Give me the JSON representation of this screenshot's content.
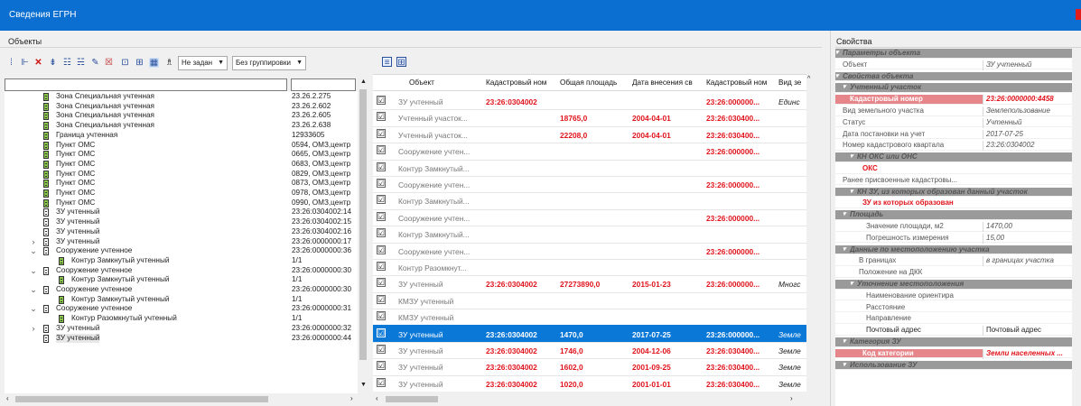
{
  "window": {
    "title": "Сведения ЕГРН"
  },
  "panels": {
    "objects": "Объекты",
    "properties": "Свойства"
  },
  "toolbar": {
    "mode_combo": "Не задан",
    "group_combo": "Без группировки"
  },
  "tree": {
    "rows": [
      {
        "name": "Зона Специальная учтенная",
        "code": "23.26.2.275",
        "expander": ""
      },
      {
        "name": "Зона Специальная учтенная",
        "code": "23.26.2.602",
        "expander": ""
      },
      {
        "name": "Зона Специальная учтенная",
        "code": "23.26.2.605",
        "expander": ""
      },
      {
        "name": "Зона Специальная учтенная",
        "code": "23.26.2.638",
        "expander": ""
      },
      {
        "name": "Граница учтенная",
        "code": "12933605",
        "expander": ""
      },
      {
        "name": "Пункт ОМС",
        "code": "0594, ОМЗ,центр",
        "expander": ""
      },
      {
        "name": "Пункт ОМС",
        "code": "0665, ОМЗ,центр",
        "expander": ""
      },
      {
        "name": "Пункт ОМС",
        "code": "0683, ОМЗ,центр",
        "expander": ""
      },
      {
        "name": "Пункт ОМС",
        "code": "0829, ОМЗ,центр",
        "expander": ""
      },
      {
        "name": "Пункт ОМС",
        "code": "0873, ОМЗ,центр",
        "expander": ""
      },
      {
        "name": "Пункт ОМС",
        "code": "0978, ОМЗ,центр",
        "expander": ""
      },
      {
        "name": "Пункт ОМС",
        "code": "0990, ОМЗ,центр",
        "expander": ""
      },
      {
        "name": "ЗУ учтенный",
        "code": "23:26:0304002:14",
        "expander": ""
      },
      {
        "name": "ЗУ учтенный",
        "code": "23:26:0304002:15",
        "expander": ""
      },
      {
        "name": "ЗУ учтенный",
        "code": "23:26:0304002:16",
        "expander": ""
      },
      {
        "name": "ЗУ учтенный",
        "code": "23:26:0000000:17",
        "expander": "›"
      },
      {
        "name": "Сооружение учтенное",
        "code": "23:26:0000000:36",
        "expander": "⌄"
      },
      {
        "name": "Контур Замкнутый учтенный",
        "code": "1/1",
        "expander": ""
      },
      {
        "name": "Сооружение учтенное",
        "code": "23:26:0000000:30",
        "expander": "⌄"
      },
      {
        "name": "Контур Замкнутый учтенный",
        "code": "1/1",
        "expander": ""
      },
      {
        "name": "Сооружение учтенное",
        "code": "23:26:0000000:30",
        "expander": "⌄"
      },
      {
        "name": "Контур Замкнутый учтенный",
        "code": "1/1",
        "expander": ""
      },
      {
        "name": "Сооружение учтенное",
        "code": "23:26:0000000:31",
        "expander": "⌄"
      },
      {
        "name": "Контур Разомкнутый учтенный",
        "code": "1/1",
        "expander": ""
      },
      {
        "name": "ЗУ учтенный",
        "code": "23:26:0000000:32",
        "expander": "›"
      },
      {
        "name": "ЗУ учтенный",
        "code": "23:26:0000000:44",
        "expander": ""
      }
    ]
  },
  "grid": {
    "columns": [
      "Объект",
      "Кадастровый ном",
      "Общая площадь",
      "Дата внесения св",
      "Кадастровый ном",
      "Вид зе"
    ],
    "rows": [
      {
        "obj": "ЗУ учтенный",
        "kad": "23:26:0304002",
        "area": "",
        "date": "",
        "kad2": "23:26:000000...",
        "vid": "Единс"
      },
      {
        "obj": "Учтенный участок...",
        "kad": "",
        "area": "18765,0",
        "date": "2004-04-01",
        "kad2": "23:26:030400...",
        "vid": ""
      },
      {
        "obj": "Учтенный участок...",
        "kad": "",
        "area": "22208,0",
        "date": "2004-04-01",
        "kad2": "23:26:030400...",
        "vid": ""
      },
      {
        "obj": "Сооружение учтен...",
        "kad": "",
        "area": "",
        "date": "",
        "kad2": "23:26:000000...",
        "vid": ""
      },
      {
        "obj": "Контур Замкнутый...",
        "kad": "",
        "area": "",
        "date": "",
        "kad2": "",
        "vid": ""
      },
      {
        "obj": "Сооружение учтен...",
        "kad": "",
        "area": "",
        "date": "",
        "kad2": "23:26:000000...",
        "vid": ""
      },
      {
        "obj": "Контур Замкнутый...",
        "kad": "",
        "area": "",
        "date": "",
        "kad2": "",
        "vid": ""
      },
      {
        "obj": "Сооружение учтен...",
        "kad": "",
        "area": "",
        "date": "",
        "kad2": "23:26:000000...",
        "vid": ""
      },
      {
        "obj": "Контур Замкнутый...",
        "kad": "",
        "area": "",
        "date": "",
        "kad2": "",
        "vid": ""
      },
      {
        "obj": "Сооружение учтен...",
        "kad": "",
        "area": "",
        "date": "",
        "kad2": "23:26:000000...",
        "vid": ""
      },
      {
        "obj": "Контур Разомкнут...",
        "kad": "",
        "area": "",
        "date": "",
        "kad2": "",
        "vid": ""
      },
      {
        "obj": "ЗУ учтенный",
        "kad": "23:26:0304002",
        "area": "27273890,0",
        "date": "2015-01-23",
        "kad2": "23:26:000000...",
        "vid": "Многс"
      },
      {
        "obj": "КМЗУ учтенный",
        "kad": "",
        "area": "",
        "date": "",
        "kad2": "",
        "vid": ""
      },
      {
        "obj": "КМЗУ учтенный",
        "kad": "",
        "area": "",
        "date": "",
        "kad2": "",
        "vid": ""
      },
      {
        "obj": "ЗУ учтенный",
        "kad": "23:26:0304002",
        "area": "1470,0",
        "date": "2017-07-25",
        "kad2": "23:26:000000...",
        "vid": "Земле"
      },
      {
        "obj": "ЗУ учтенный",
        "kad": "23:26:0304002",
        "area": "1746,0",
        "date": "2004-12-06",
        "kad2": "23:26:030400...",
        "vid": "Земле"
      },
      {
        "obj": "ЗУ учтенный",
        "kad": "23:26:0304002",
        "area": "1602,0",
        "date": "2001-09-25",
        "kad2": "23:26:030400...",
        "vid": "Земле"
      },
      {
        "obj": "ЗУ учтенный",
        "kad": "23:26:0304002",
        "area": "1020,0",
        "date": "2001-01-01",
        "kad2": "23:26:030400...",
        "vid": "Земле"
      }
    ],
    "check_mark": "☑"
  },
  "properties": {
    "rows": [
      {
        "name": "Параметры объекта",
        "value": ""
      },
      {
        "name": "Объект",
        "value": "ЗУ учтенный"
      },
      {
        "name": "Свойства объекта",
        "value": ""
      },
      {
        "name": "Учтенный участок",
        "value": ""
      },
      {
        "name": "Кадастровый номер",
        "value": "23:26:0000000:4458"
      },
      {
        "name": "Вид земельного участка",
        "value": "Землепользование"
      },
      {
        "name": "Статус",
        "value": "Учтенный"
      },
      {
        "name": "Дата постановки на учет",
        "value": "2017-07-25"
      },
      {
        "name": "Номер кадастрового квартала",
        "value": "23:26:0304002"
      },
      {
        "name": "КН ОКС или ОНС",
        "value": ""
      },
      {
        "name": "ОКС",
        "value": ""
      },
      {
        "name": "Ранее присвоенные кадастровы...",
        "value": ""
      },
      {
        "name": "КН ЗУ, из которых образован данный участок",
        "value": ""
      },
      {
        "name": "ЗУ из которых образован",
        "value": ""
      },
      {
        "name": "Площадь",
        "value": ""
      },
      {
        "name": "Значение площади, м2",
        "value": "1470,00"
      },
      {
        "name": "Погрешность измерения",
        "value": "15,00"
      },
      {
        "name": "Данные по местоположению участка",
        "value": ""
      },
      {
        "name": "В границах",
        "value": "в границах участка"
      },
      {
        "name": "Положение на ДКК",
        "value": ""
      },
      {
        "name": "Уточнение местоположения",
        "value": ""
      },
      {
        "name": "Наименование ориентира",
        "value": ""
      },
      {
        "name": "Расстояние",
        "value": ""
      },
      {
        "name": "Направление",
        "value": ""
      },
      {
        "name": "Почтовый адрес",
        "value": "Почтовый адрес"
      },
      {
        "name": "Категория ЗУ",
        "value": ""
      },
      {
        "name": "Код категории",
        "value": "Земли населенных ..."
      },
      {
        "name": "Использование ЗУ",
        "value": ""
      }
    ]
  }
}
